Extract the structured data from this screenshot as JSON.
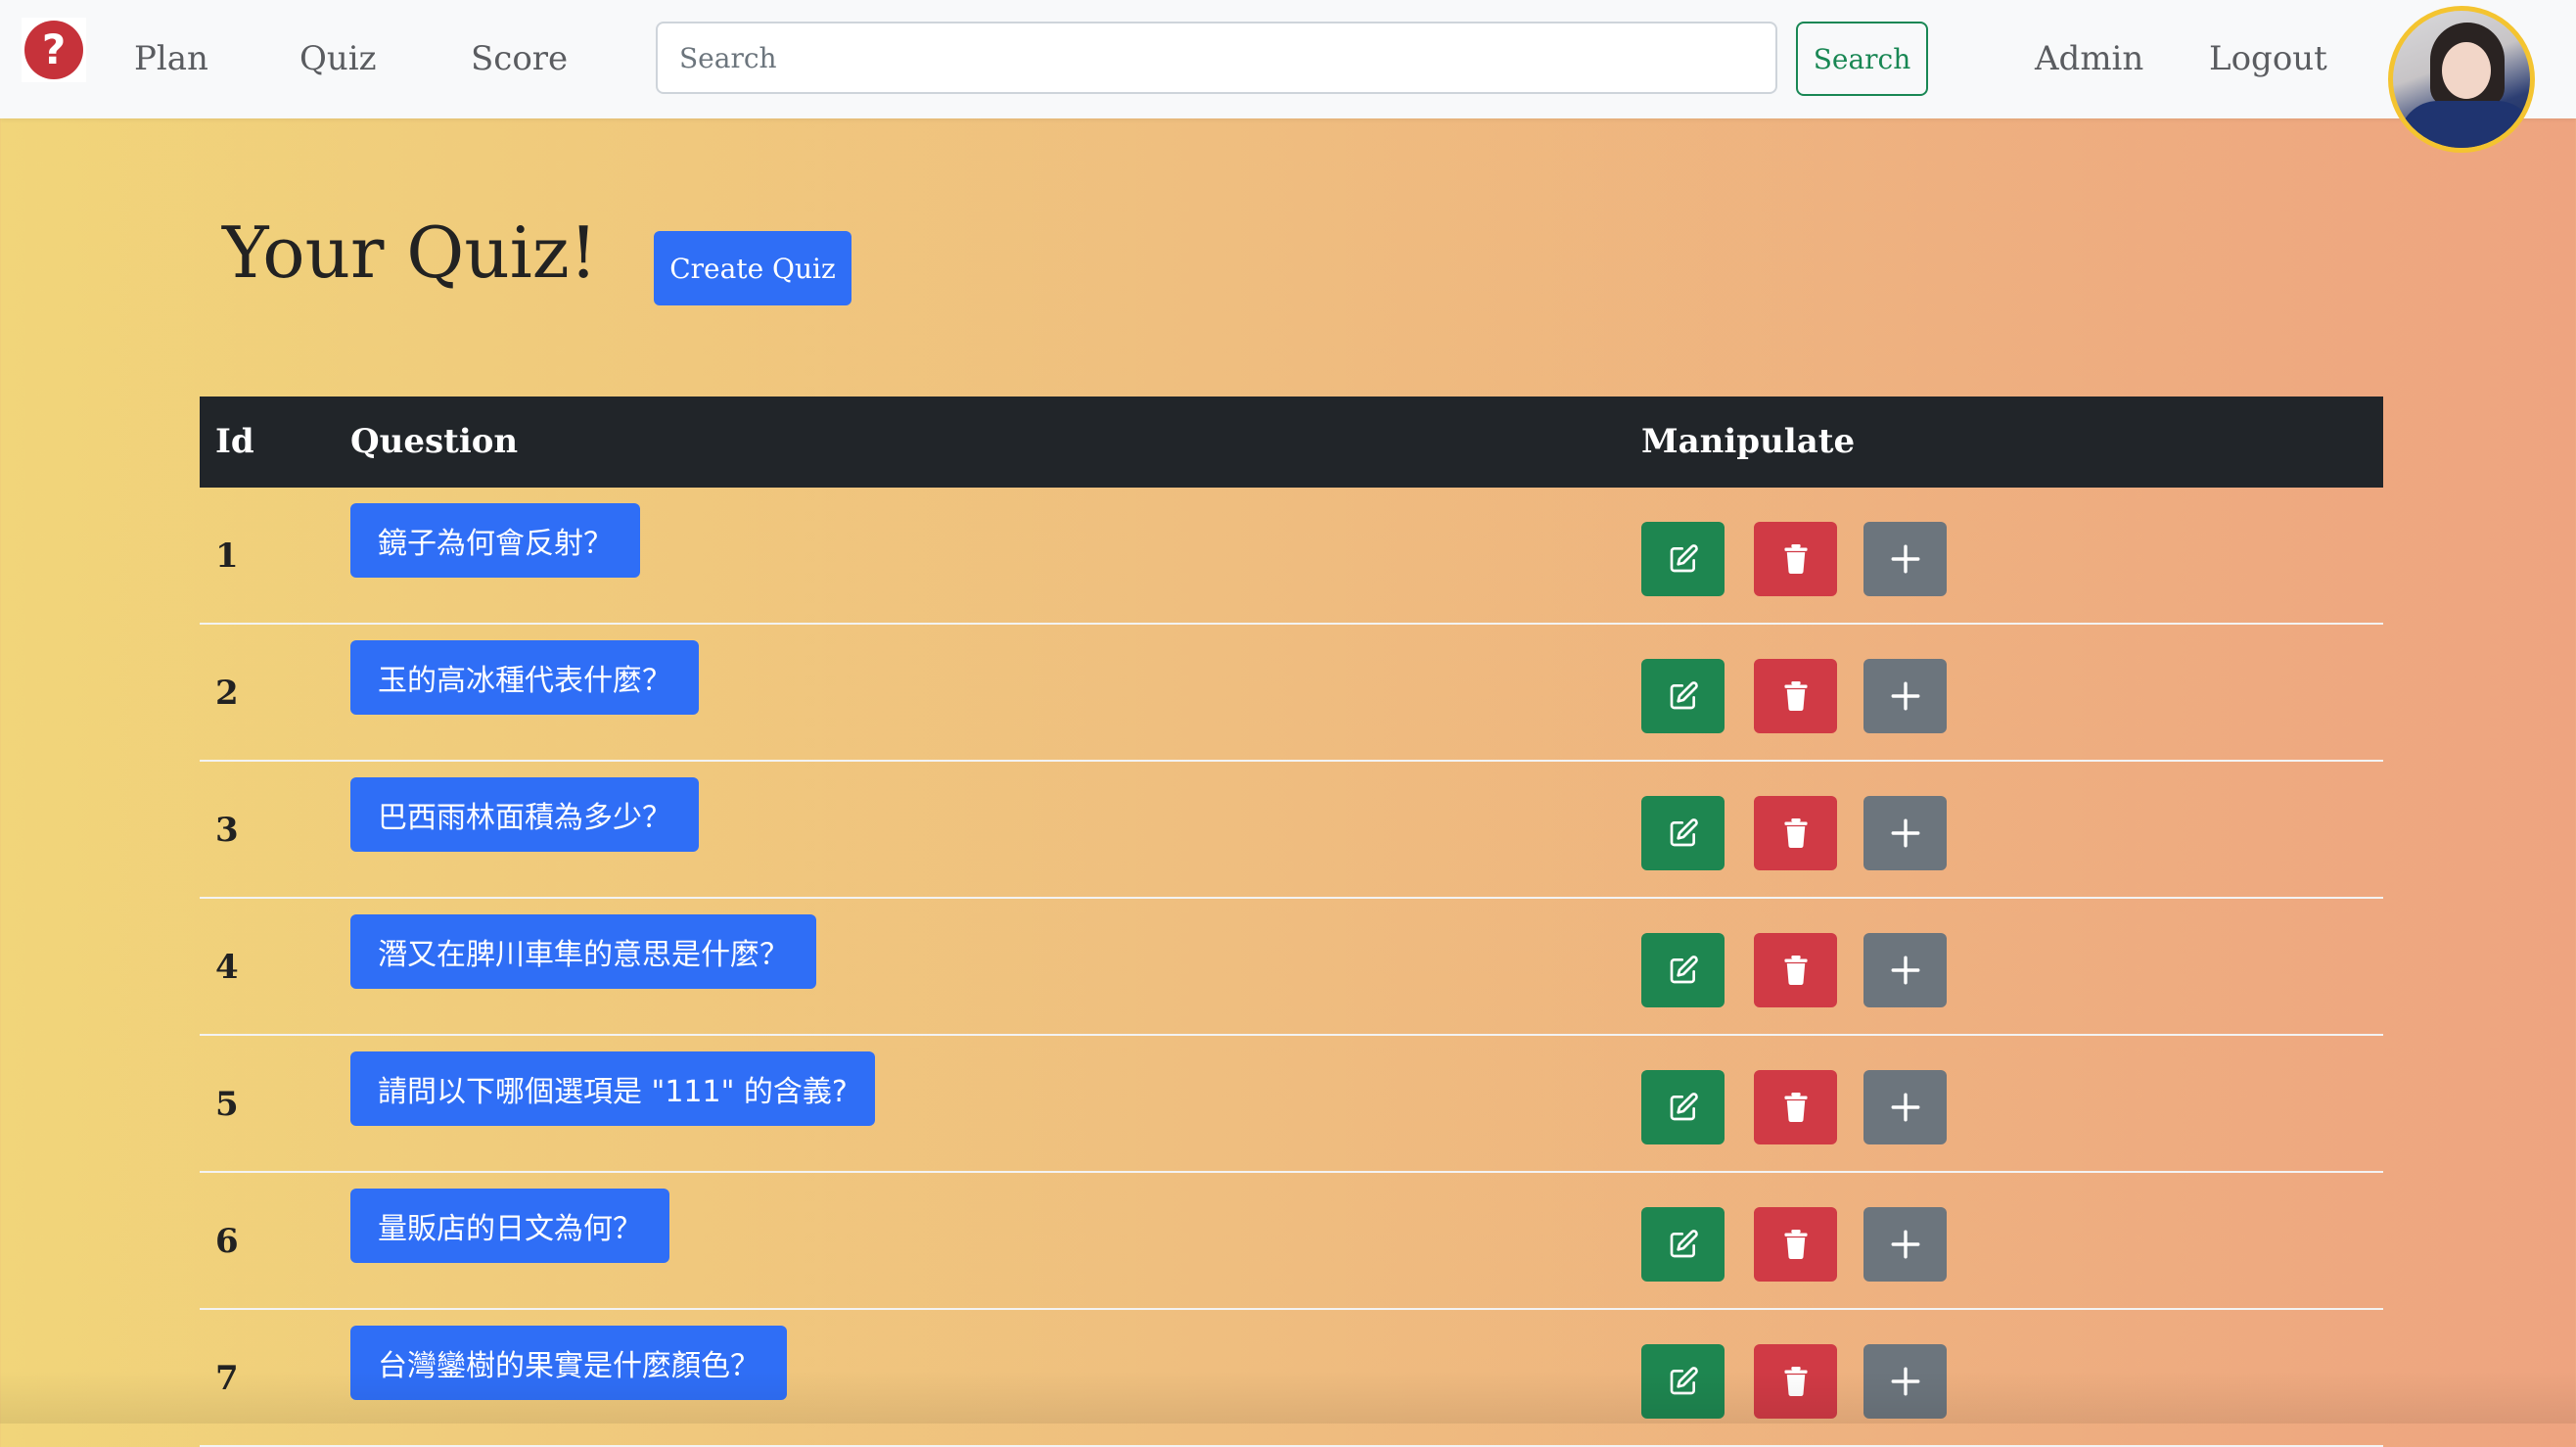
{
  "nav": {
    "logo_glyph": "?",
    "links": [
      "Plan",
      "Quiz",
      "Score"
    ],
    "search_placeholder": "Search",
    "search_button": "Search",
    "right_links": [
      "Admin",
      "Logout"
    ]
  },
  "page": {
    "title": "Your Quiz!",
    "create_button": "Create Quiz"
  },
  "table": {
    "columns": [
      "Id",
      "Question",
      "Manipulate"
    ],
    "rows": [
      {
        "id": "1",
        "question": "鏡子為何會反射？"
      },
      {
        "id": "2",
        "question": "玉的高冰種代表什麼？"
      },
      {
        "id": "3",
        "question": "巴西雨林面積為多少？"
      },
      {
        "id": "4",
        "question": "潛又在脾川車隼的意思是什麼？"
      },
      {
        "id": "5",
        "question": "請問以下哪個選項是 \"111\" 的含義?"
      },
      {
        "id": "6",
        "question": "量販店的日文為何？"
      },
      {
        "id": "7",
        "question": "台灣鑾樹的果實是什麼顏色？"
      }
    ],
    "action_icons": [
      "edit-icon",
      "trash-icon",
      "plus-icon"
    ]
  },
  "colors": {
    "primary": "#2f6ef6",
    "success": "#1e8650",
    "danger": "#d03a45",
    "secondary": "#6c757d",
    "table_header": "#212529",
    "logo": "#c6323a",
    "avatar_border": "#f4c430"
  }
}
